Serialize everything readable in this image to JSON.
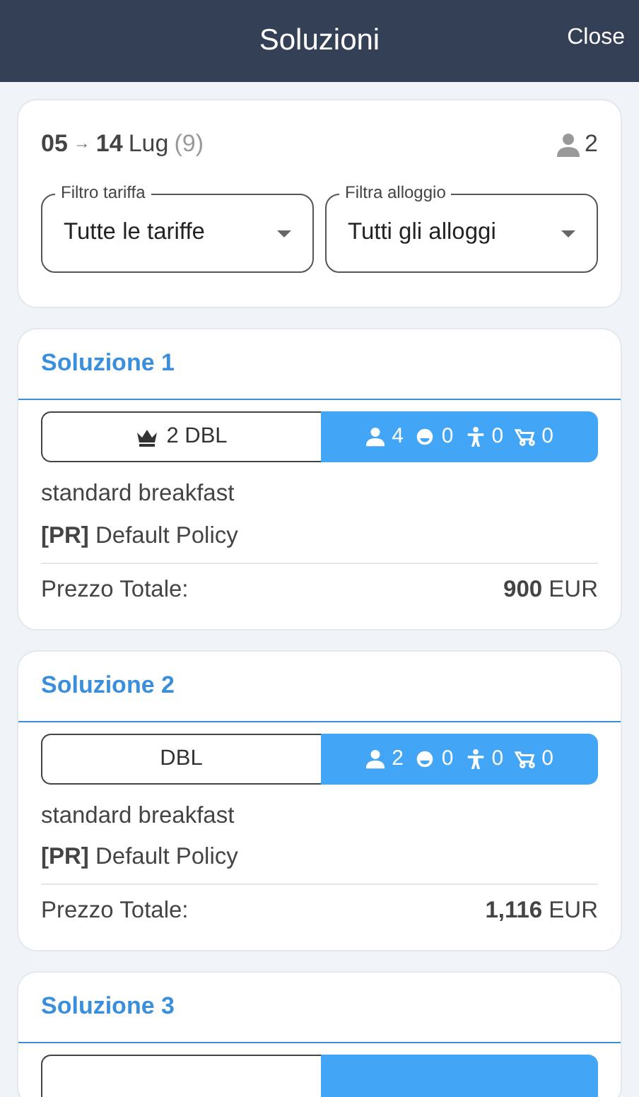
{
  "header": {
    "title": "Soluzioni",
    "close": "Close"
  },
  "search": {
    "from": "05",
    "arrow": "→",
    "to": "14",
    "month": "Lug",
    "nights": "(9)",
    "guests": "2",
    "filters": [
      {
        "label": "Filtro tariffa",
        "value": "Tutte le tariffe"
      },
      {
        "label": "Filtra alloggio",
        "value": "Tutti gli alloggi"
      }
    ]
  },
  "solutions": [
    {
      "title": "Soluzione 1",
      "room": {
        "crown_icon": true,
        "name": "2 DBL",
        "adults": "4",
        "children": "0",
        "infants": "0",
        "babies": "0"
      },
      "board": "standard breakfast",
      "policy": "**[PR]** Default Policy",
      "price_label": "Prezzo Totale:",
      "price": "**900** EUR"
    },
    {
      "title": "Soluzione 2",
      "room": {
        "crown_icon": false,
        "name": "DBL",
        "adults": "2",
        "children": "0",
        "infants": "0",
        "babies": "0"
      },
      "board": "standard breakfast",
      "policy": "**[PR]** Default Policy",
      "price_label": "Prezzo Totale:",
      "price": "**1,116** EUR"
    },
    {
      "title": "Soluzione 3",
      "room_row_cut": true
    }
  ]
}
